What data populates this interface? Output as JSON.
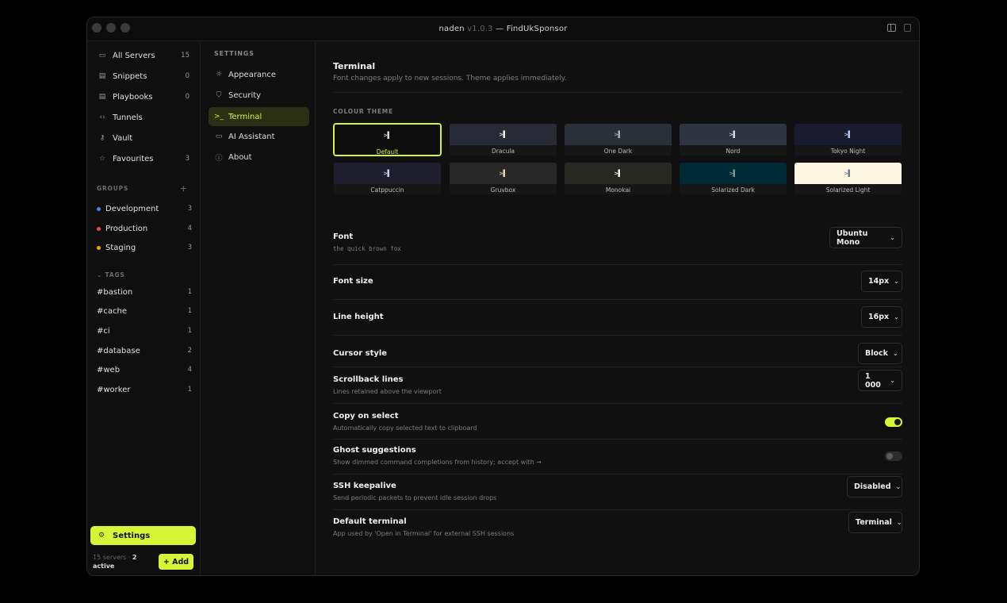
{
  "window": {
    "app_name": "naden",
    "version": "v1.0.3",
    "separator": "—",
    "context": "FindUkSponsor"
  },
  "sidebar": {
    "nav": [
      {
        "label": "All Servers",
        "count": "15",
        "icon": "monitor-icon"
      },
      {
        "label": "Snippets",
        "count": "0",
        "icon": "snippet-icon"
      },
      {
        "label": "Playbooks",
        "count": "0",
        "icon": "playbook-icon"
      },
      {
        "label": "Tunnels",
        "count": "",
        "icon": "tunnel-icon"
      },
      {
        "label": "Vault",
        "count": "",
        "icon": "key-icon"
      },
      {
        "label": "Favourites",
        "count": "3",
        "icon": "star-icon"
      }
    ],
    "groups_label": "GROUPS",
    "groups": [
      {
        "label": "Development",
        "count": "3",
        "color": "#3b82f6"
      },
      {
        "label": "Production",
        "count": "4",
        "color": "#ef4444"
      },
      {
        "label": "Staging",
        "count": "3",
        "color": "#f59e0b"
      }
    ],
    "tags_label": "TAGS",
    "tags": [
      {
        "label": "#bastion",
        "count": "1"
      },
      {
        "label": "#cache",
        "count": "1"
      },
      {
        "label": "#ci",
        "count": "1"
      },
      {
        "label": "#database",
        "count": "2"
      },
      {
        "label": "#web",
        "count": "4"
      },
      {
        "label": "#worker",
        "count": "1"
      }
    ],
    "settings_label": "Settings",
    "footer": {
      "servers": "15 servers ·",
      "active_count": "2",
      "active_label": "active"
    },
    "add_label": "+ Add"
  },
  "settings_menu": {
    "label": "SETTINGS",
    "items": [
      {
        "label": "Appearance",
        "icon": "sun-icon",
        "active": false
      },
      {
        "label": "Security",
        "icon": "shield-icon",
        "active": false
      },
      {
        "label": "Terminal",
        "icon": "terminal-icon",
        "active": true
      },
      {
        "label": "AI Assistant",
        "icon": "chat-icon",
        "active": false
      },
      {
        "label": "About",
        "icon": "info-icon",
        "active": false
      }
    ]
  },
  "terminal": {
    "title": "Terminal",
    "subtitle": "Font changes apply to new sessions. Theme applies immediately.",
    "colour_theme_label": "COLOUR THEME",
    "themes": [
      {
        "name": "Default",
        "bg": "#0d0d0d",
        "fg": "#dddddd",
        "selected": true
      },
      {
        "name": "Dracula",
        "bg": "#282a36",
        "fg": "#f8f8f2",
        "selected": false
      },
      {
        "name": "One Dark",
        "bg": "#2b2f37",
        "fg": "#abb2bf",
        "selected": false
      },
      {
        "name": "Nord",
        "bg": "#2e3440",
        "fg": "#d8dee9",
        "selected": false
      },
      {
        "name": "Tokyo Night",
        "bg": "#1a1b2e",
        "fg": "#c0caf5",
        "selected": false
      },
      {
        "name": "Catppuccin",
        "bg": "#1e1e2e",
        "fg": "#cdd6f4",
        "selected": false
      },
      {
        "name": "Gruvbox",
        "bg": "#282828",
        "fg": "#ebdbb2",
        "selected": false
      },
      {
        "name": "Monokai",
        "bg": "#272822",
        "fg": "#f8f8f2",
        "selected": false
      },
      {
        "name": "Solarized Dark",
        "bg": "#002b36",
        "fg": "#839496",
        "selected": false
      },
      {
        "name": "Solarized Light",
        "bg": "#fdf6e3",
        "fg": "#657b83",
        "selected": false
      }
    ],
    "prompt_glyph": ">▌",
    "rows": [
      {
        "key": "font",
        "label": "Font",
        "desc": "the quick brown fox",
        "mono_desc": true,
        "control": "select",
        "value": "Ubuntu Mono"
      },
      {
        "key": "font_size",
        "label": "Font size",
        "desc": "",
        "control": "select",
        "value": "14px"
      },
      {
        "key": "line_height",
        "label": "Line height",
        "desc": "",
        "control": "select",
        "value": "16px"
      },
      {
        "key": "cursor_style",
        "label": "Cursor style",
        "desc": "",
        "control": "select",
        "value": "Block"
      },
      {
        "key": "scrollback",
        "label": "Scrollback lines",
        "desc": "Lines retained above the viewport",
        "control": "select",
        "value": "1 000"
      },
      {
        "key": "copy_on_select",
        "label": "Copy on select",
        "desc": "Automatically copy selected text to clipboard",
        "control": "toggle",
        "value": true
      },
      {
        "key": "ghost",
        "label": "Ghost suggestions",
        "desc": "Show dimmed command completions from history; accept with →",
        "control": "toggle",
        "value": false
      },
      {
        "key": "keepalive",
        "label": "SSH keepalive",
        "desc": "Send periodic packets to prevent idle session drops",
        "control": "select",
        "value": "Disabled"
      },
      {
        "key": "default_terminal",
        "label": "Default terminal",
        "desc": "App used by 'Open in Terminal' for external SSH sessions",
        "control": "select",
        "value": "Terminal"
      }
    ]
  },
  "colors": {
    "accent": "#d6f537",
    "background": "#101010"
  }
}
